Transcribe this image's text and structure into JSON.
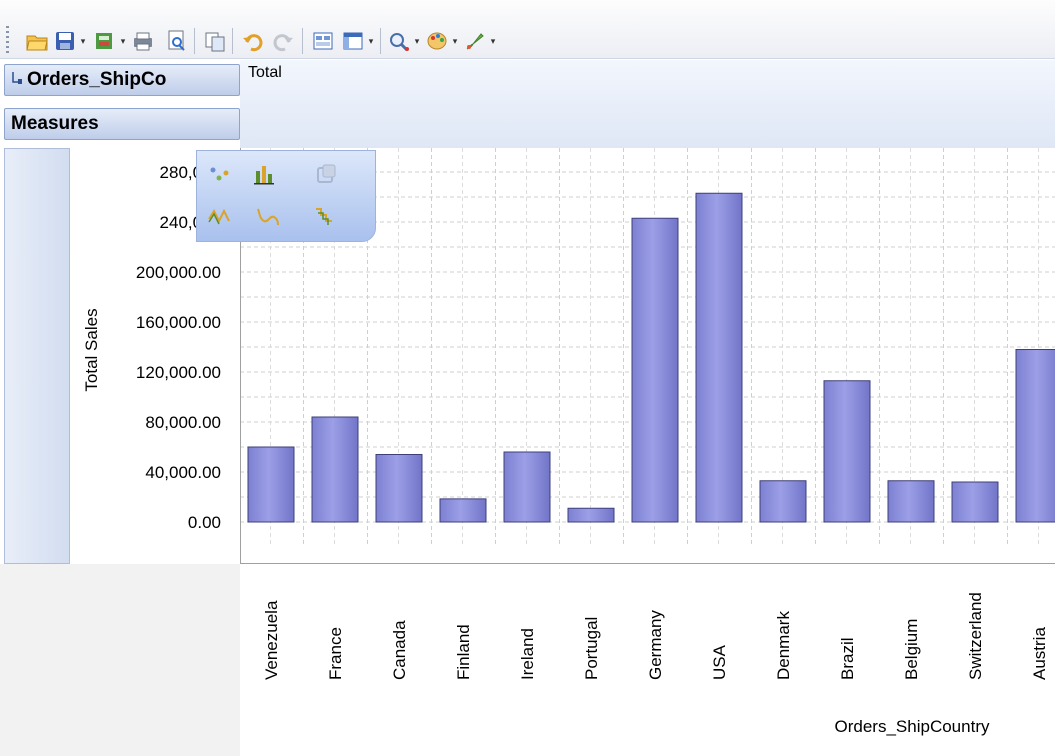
{
  "toolbar": {
    "icons": [
      "open-folder-icon",
      "save-icon",
      "export-icon",
      "print-icon",
      "print-preview-icon",
      "copy-icon",
      "undo-icon",
      "redo-icon",
      "field-list-icon",
      "layout-icon",
      "zoom-icon",
      "color-palette-icon",
      "style-brush-icon"
    ]
  },
  "fields": {
    "row_field": "Orders_ShipCo",
    "measures": "Measures"
  },
  "column_header": "Total",
  "chart_data": {
    "type": "bar",
    "categories": [
      "Venezuela",
      "France",
      "Canada",
      "Finland",
      "Ireland",
      "Portugal",
      "Germany",
      "USA",
      "Denmark",
      "Brazil",
      "Belgium",
      "Switzerland",
      "Austria"
    ],
    "values": [
      60000,
      84000,
      54000,
      18500,
      56000,
      11000,
      243000,
      263000,
      33000,
      113000,
      33000,
      32000,
      138000
    ],
    "xlabel": "Orders_ShipCountry",
    "ylabel": "Total Sales",
    "ylim": [
      0,
      280000
    ],
    "yticks": [
      "0.00",
      "40,000.00",
      "80,000.00",
      "120,000.00",
      "160,000.00",
      "200,000.00",
      "240,000",
      "280,000"
    ],
    "grid": true,
    "bar_color": "#9c9fe6"
  },
  "chart_types": {
    "row1": [
      "scatter-chart-icon",
      "bar-chart-icon",
      "pie-chart-icon"
    ],
    "row2": [
      "line-chart-icon",
      "spline-chart-icon",
      "step-line-chart-icon"
    ]
  }
}
